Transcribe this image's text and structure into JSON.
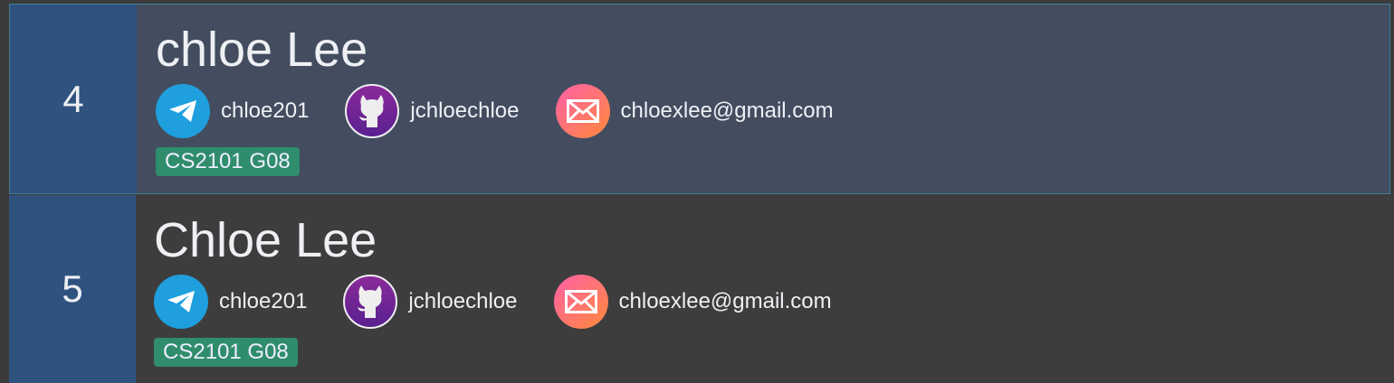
{
  "persons": [
    {
      "index": "4",
      "name": "chloe Lee",
      "telegram": "chloe201",
      "github": "jchloechloe",
      "email": "chloexlee@gmail.com",
      "tag": "CS2101 G08",
      "selected": true
    },
    {
      "index": "5",
      "name": "Chloe Lee",
      "telegram": "chloe201",
      "github": "jchloechloe",
      "email": "chloexlee@gmail.com",
      "tag": "CS2101 G08",
      "selected": false
    }
  ],
  "colors": {
    "index_bg": "#30527f",
    "selected_bg": "#434d5f",
    "tag_bg": "#2f8d6c",
    "telegram": "#1f9fdd"
  }
}
